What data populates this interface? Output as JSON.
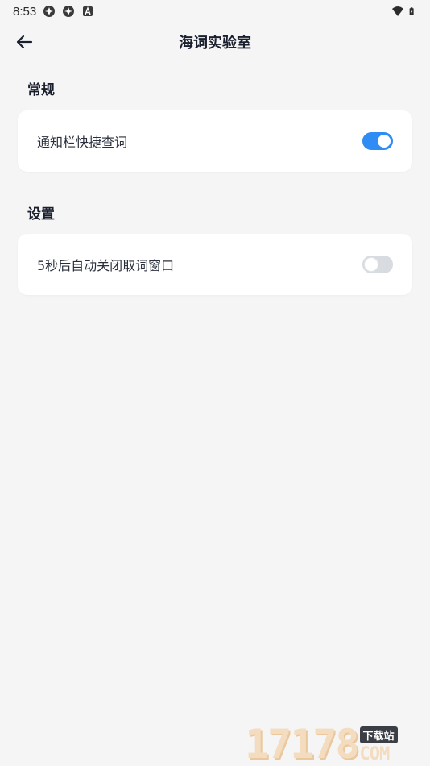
{
  "status_bar": {
    "time": "8:53"
  },
  "app_bar": {
    "title": "海词实验室"
  },
  "sections": [
    {
      "header": "常规",
      "items": [
        {
          "label": "通知栏快捷查词",
          "enabled": true
        }
      ]
    },
    {
      "header": "设置",
      "items": [
        {
          "label": "5秒后自动关闭取词窗口",
          "enabled": false
        }
      ]
    }
  ],
  "colors": {
    "accent": "#2f8cf4",
    "background": "#f5f5f5",
    "card": "#ffffff",
    "toggle_off": "#d8dbe0"
  },
  "watermark": {
    "digits": "17178",
    "badge": "下载站",
    "suffix": "COM"
  }
}
